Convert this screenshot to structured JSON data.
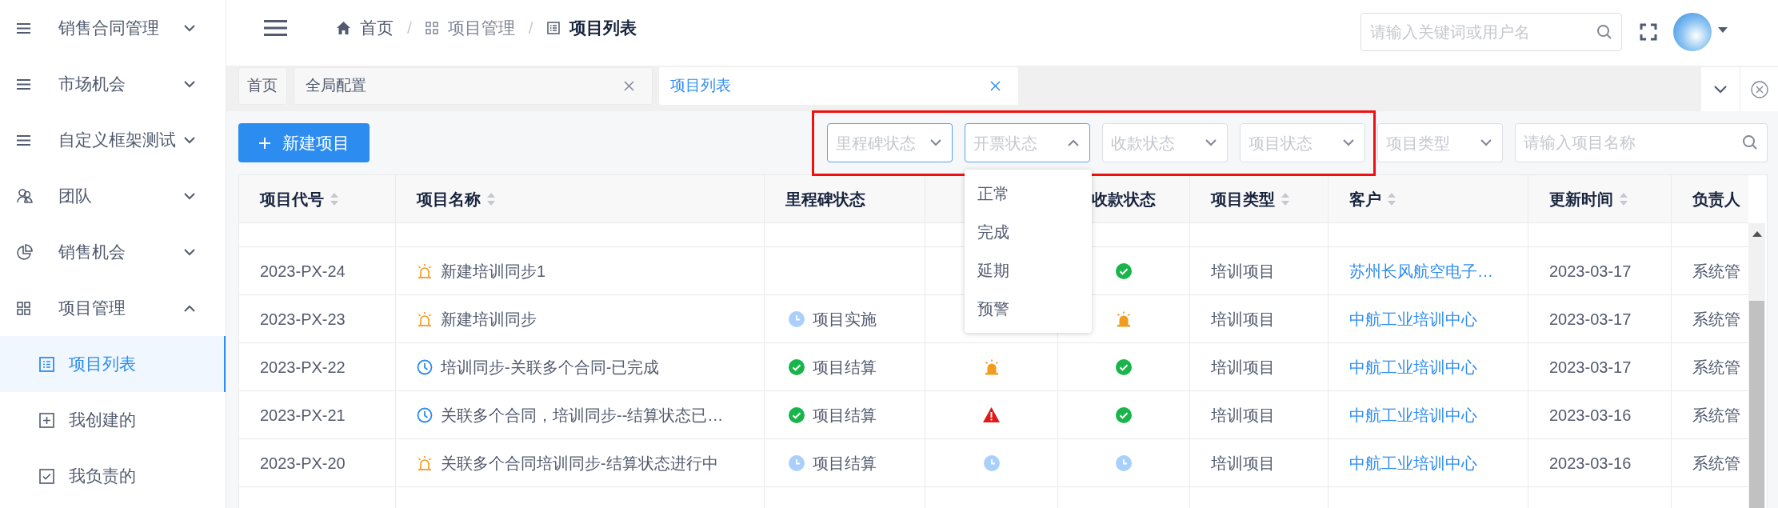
{
  "sidebar": {
    "items": [
      {
        "label": "销售合同管理",
        "expanded": false
      },
      {
        "label": "市场机会",
        "expanded": false
      },
      {
        "label": "自定义框架测试",
        "expanded": false
      },
      {
        "label": "团队",
        "expanded": false
      },
      {
        "label": "销售机会",
        "expanded": false
      },
      {
        "label": "项目管理",
        "expanded": true,
        "children": [
          {
            "label": "项目列表",
            "selected": true
          },
          {
            "label": "我创建的",
            "selected": false
          },
          {
            "label": "我负责的",
            "selected": false
          }
        ]
      }
    ]
  },
  "header": {
    "breadcrumb": [
      "首页",
      "项目管理",
      "项目列表"
    ],
    "separators": [
      "/",
      "/"
    ],
    "search": {
      "placeholder": "请输入关键词或用户名"
    }
  },
  "tabs": [
    {
      "label": "首页",
      "selected": false,
      "closable": false
    },
    {
      "label": "全局配置",
      "selected": false,
      "closable": true
    },
    {
      "label": "项目列表",
      "selected": true,
      "closable": true
    }
  ],
  "toolbar": {
    "new_button": "新建项目",
    "annotation_frame": true,
    "filters": [
      {
        "placeholder": "里程碑状态",
        "active": true,
        "open": false
      },
      {
        "placeholder": "开票状态",
        "active": true,
        "open": true,
        "options": [
          "正常",
          "完成",
          "延期",
          "预警"
        ]
      },
      {
        "placeholder": "收款状态",
        "active": false,
        "open": false
      },
      {
        "placeholder": "项目状态",
        "active": false,
        "open": false
      },
      {
        "placeholder": "项目类型",
        "active": false,
        "open": false
      }
    ],
    "name_search": {
      "placeholder": "请输入项目名称"
    }
  },
  "table": {
    "columns": [
      {
        "label": "项目代号",
        "sortable": true
      },
      {
        "label": "项目名称",
        "sortable": true
      },
      {
        "label": "里程碑状态",
        "sortable": false
      },
      {},
      {
        "label": "收款状态",
        "sortable": false
      },
      {
        "label": "项目类型",
        "sortable": true
      },
      {
        "label": "客户",
        "sortable": true
      },
      {
        "label": "更新时间",
        "sortable": true
      },
      {
        "label": "负责人",
        "sortable": false
      }
    ],
    "rows": [
      {
        "code": "2023-PX-24",
        "name_marker": {
          "kind": "alert"
        },
        "name": "新建培训同步1",
        "payment": {
          "kind": "done"
        },
        "type": "培训项目",
        "customer": "苏州长风航空电子…",
        "updated": "2023-03-17",
        "owner": "系统管"
      },
      {
        "code": "2023-PX-23",
        "name_marker": {
          "kind": "alert"
        },
        "name": "新建培训同步",
        "milestone": {
          "kind": "pending",
          "label": "项目实施"
        },
        "payment": {
          "kind": "alert"
        },
        "type": "培训项目",
        "customer": "中航工业培训中心",
        "updated": "2023-03-17",
        "owner": "系统管"
      },
      {
        "code": "2023-PX-22",
        "name_marker": {
          "kind": "scheduled"
        },
        "name": "培训同步-关联多个合同-已完成",
        "milestone": {
          "kind": "done",
          "label": "项目结算"
        },
        "invoice": {
          "kind": "alert"
        },
        "payment": {
          "kind": "done"
        },
        "type": "培训项目",
        "customer": "中航工业培训中心",
        "updated": "2023-03-17",
        "owner": "系统管"
      },
      {
        "code": "2023-PX-21",
        "name_marker": {
          "kind": "scheduled"
        },
        "name": "关联多个合同，培训同步--结算状态已…",
        "milestone": {
          "kind": "done",
          "label": "项目结算"
        },
        "invoice": {
          "kind": "error"
        },
        "payment": {
          "kind": "done"
        },
        "type": "培训项目",
        "customer": "中航工业培训中心",
        "updated": "2023-03-16",
        "owner": "系统管"
      },
      {
        "code": "2023-PX-20",
        "name_marker": {
          "kind": "alert"
        },
        "name": "关联多个合同培训同步-结算状态进行中",
        "milestone": {
          "kind": "pending",
          "label": "项目结算"
        },
        "invoice": {
          "kind": "pending"
        },
        "payment": {
          "kind": "pending"
        },
        "type": "培训项目",
        "customer": "中航工业培训中心",
        "updated": "2023-03-16",
        "owner": "系统管"
      }
    ]
  }
}
